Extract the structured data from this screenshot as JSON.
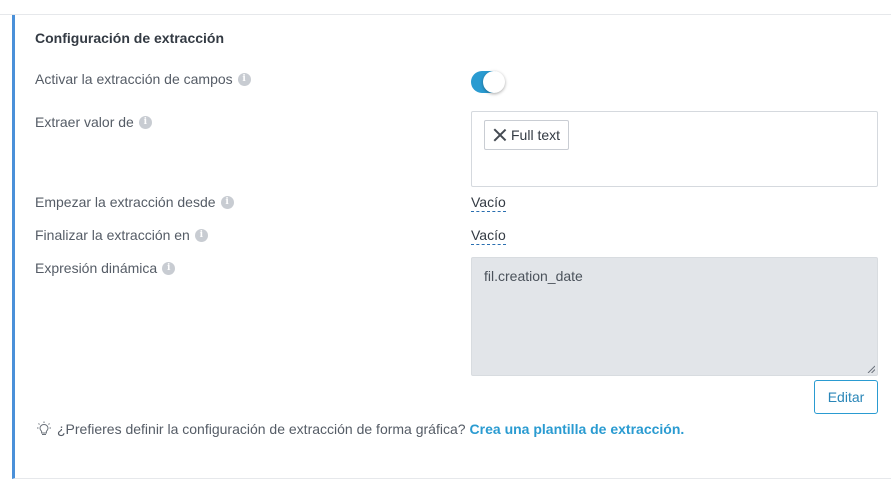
{
  "section": {
    "title": "Configuración de extracción"
  },
  "fields": {
    "activate": {
      "label": "Activar la extracción de campos",
      "enabled": true
    },
    "extract_from": {
      "label": "Extraer valor de",
      "chips": [
        "Full text"
      ]
    },
    "start": {
      "label": "Empezar la extracción desde",
      "value": "Vacío"
    },
    "end": {
      "label": "Finalizar la extracción en",
      "value": "Vacío"
    },
    "expression": {
      "label": "Expresión dinámica",
      "value": "fil.creation_date"
    }
  },
  "actions": {
    "edit_label": "Editar"
  },
  "hint": {
    "text": "¿Prefieres definir la configuración de extracción de forma gráfica?",
    "link": "Crea una plantilla de extracción."
  },
  "colors": {
    "accent": "#2a9bd1",
    "panel_border": "#4a90d9",
    "textarea_bg": "#e2e5e9"
  },
  "icons": {
    "info": "info-icon",
    "chip_close": "close-icon",
    "hint": "lightbulb-icon"
  }
}
